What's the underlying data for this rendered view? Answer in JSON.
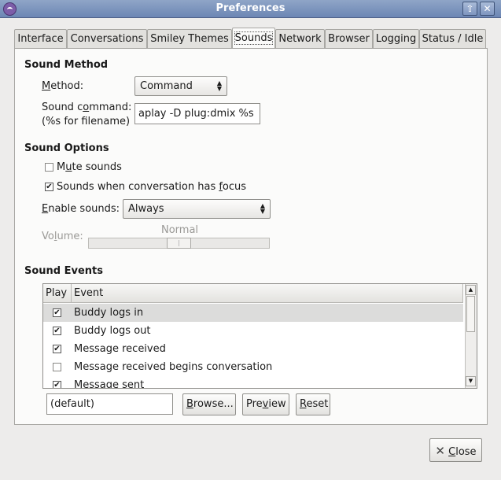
{
  "window": {
    "title": "Preferences"
  },
  "tabs": [
    {
      "label": "Interface"
    },
    {
      "label": "Conversations"
    },
    {
      "label": "Smiley Themes"
    },
    {
      "label": "Sounds"
    },
    {
      "label": "Network"
    },
    {
      "label": "Browser"
    },
    {
      "label": "Logging"
    },
    {
      "label": "Status / Idle"
    }
  ],
  "sound_method": {
    "heading": "Sound Method",
    "method_label_u": "M",
    "method_label_rest": "ethod:",
    "method_value": "Command",
    "command_label_pre": "Sound c",
    "command_label_u": "o",
    "command_label_post": "mmand:",
    "command_hint": "(%s for filename)",
    "command_value": "aplay -D plug:dmix %s"
  },
  "sound_options": {
    "heading": "Sound Options",
    "mute_pre": "M",
    "mute_u": "u",
    "mute_post": "te sounds",
    "mute_checked": false,
    "focus_label_pre": "Sounds when conversation has ",
    "focus_label_u": "f",
    "focus_label_post": "ocus",
    "focus_checked": true,
    "enable_label_u": "E",
    "enable_label_rest": "nable sounds:",
    "enable_value": "Always",
    "volume_label_pre": "Vo",
    "volume_label_u": "l",
    "volume_label_post": "ume:",
    "volume_value_text": "Normal"
  },
  "sound_events": {
    "heading": "Sound Events",
    "columns": [
      "Play",
      "Event"
    ],
    "rows": [
      {
        "play": true,
        "event": "Buddy logs in",
        "selected": true
      },
      {
        "play": true,
        "event": "Buddy logs out",
        "selected": false
      },
      {
        "play": true,
        "event": "Message received",
        "selected": false
      },
      {
        "play": false,
        "event": "Message received begins conversation",
        "selected": false
      },
      {
        "play": true,
        "event": "Message sent",
        "selected": false
      }
    ],
    "file_value": "(default)",
    "browse_pre": "",
    "browse_u": "B",
    "browse_post": "rowse...",
    "preview_pre": "Pre",
    "preview_u": "v",
    "preview_post": "iew",
    "reset_pre": "",
    "reset_u": "R",
    "reset_post": "eset"
  },
  "footer": {
    "close_u": "C",
    "close_rest": "lose"
  },
  "glyphs": {
    "check": "✔",
    "up": "▲",
    "down": "▼",
    "close_x": "✕",
    "max": "⇧"
  }
}
